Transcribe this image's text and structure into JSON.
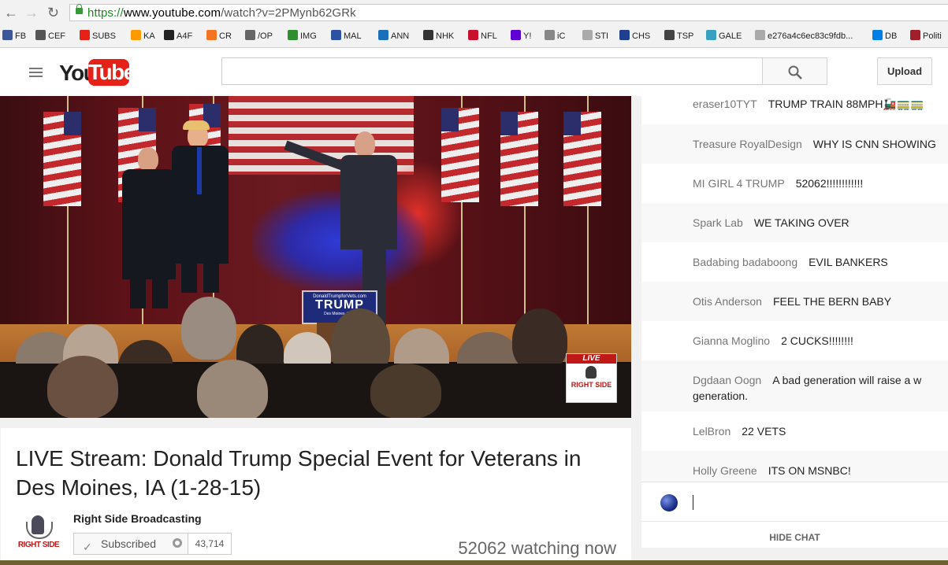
{
  "browser": {
    "url_protocol": "https://",
    "url_host": "www.youtube.com",
    "url_path": "/watch?v=2PMynb62GRk",
    "bookmarks": [
      {
        "label": "FB",
        "color": "#3b5998"
      },
      {
        "label": "CEF",
        "color": "#555555"
      },
      {
        "label": "SUBS",
        "color": "#e62117"
      },
      {
        "label": "KA",
        "color": "#ff9900"
      },
      {
        "label": "A4F",
        "color": "#222222"
      },
      {
        "label": "CR",
        "color": "#f47521"
      },
      {
        "label": "/OP",
        "color": "#666666"
      },
      {
        "label": "IMG",
        "color": "#2f8f2f"
      },
      {
        "label": "MAL",
        "color": "#2e51a2"
      },
      {
        "label": "ANN",
        "color": "#1a6fb8"
      },
      {
        "label": "NHK",
        "color": "#333333"
      },
      {
        "label": "NFL",
        "color": "#c8102e"
      },
      {
        "label": "Y!",
        "color": "#5f01d1"
      },
      {
        "label": "iC",
        "color": "#888888"
      },
      {
        "label": "STI",
        "color": "#aaaaaa"
      },
      {
        "label": "CHS",
        "color": "#1f3f8f"
      },
      {
        "label": "TSP",
        "color": "#444444"
      },
      {
        "label": "GALE",
        "color": "#3aa0c0"
      },
      {
        "label": "e276a4c6ec83c9fdb...",
        "color": "#aaaaaa"
      },
      {
        "label": "DB",
        "color": "#007ee5"
      },
      {
        "label": "Politi",
        "color": "#a01f2a"
      }
    ]
  },
  "header": {
    "logo_you": "You",
    "logo_tube": "Tube",
    "search_placeholder": "",
    "upload_label": "Upload"
  },
  "video": {
    "podium_url": "DonaldTrumpforVets.com",
    "podium_name": "TRUMP",
    "podium_sub": "Des Moines, Iowa",
    "badge_live": "LIVE",
    "badge_channel": "RIGHT SIDE"
  },
  "info": {
    "title": "LIVE Stream: Donald Trump Special Event for Veterans in Des Moines, IA (1-28-15)",
    "channel_name": "Right Side Broadcasting",
    "avatar_text": "RIGHT SIDE",
    "subscribed_label": "Subscribed",
    "subscriber_count": "43,714",
    "watching": "52062 watching now"
  },
  "chat": {
    "messages": [
      {
        "author": "eraser10TYT",
        "text": "TRUMP TRAIN 88MPH🚂🚃🚃"
      },
      {
        "author": "Treasure RoyalDesign",
        "text": "WHY IS CNN SHOWING"
      },
      {
        "author": "MI GIRL 4 TRUMP",
        "text": "52062!!!!!!!!!!!!"
      },
      {
        "author": "Spark Lab",
        "text": "WE TAKING OVER"
      },
      {
        "author": "Badabing badaboong",
        "text": "EVIL BANKERS"
      },
      {
        "author": "Otis Anderson",
        "text": "FEEL THE BERN BABY"
      },
      {
        "author": "Gianna Moglino",
        "text": "2 CUCKS!!!!!!!!"
      },
      {
        "author": "Dgdaan Oogn",
        "text": "A bad generation will raise a w generation."
      },
      {
        "author": "LelBron",
        "text": "22 VETS"
      },
      {
        "author": "Holly Greene",
        "text": "ITS ON MSNBC!"
      }
    ],
    "hide_label": "HIDE CHAT"
  }
}
